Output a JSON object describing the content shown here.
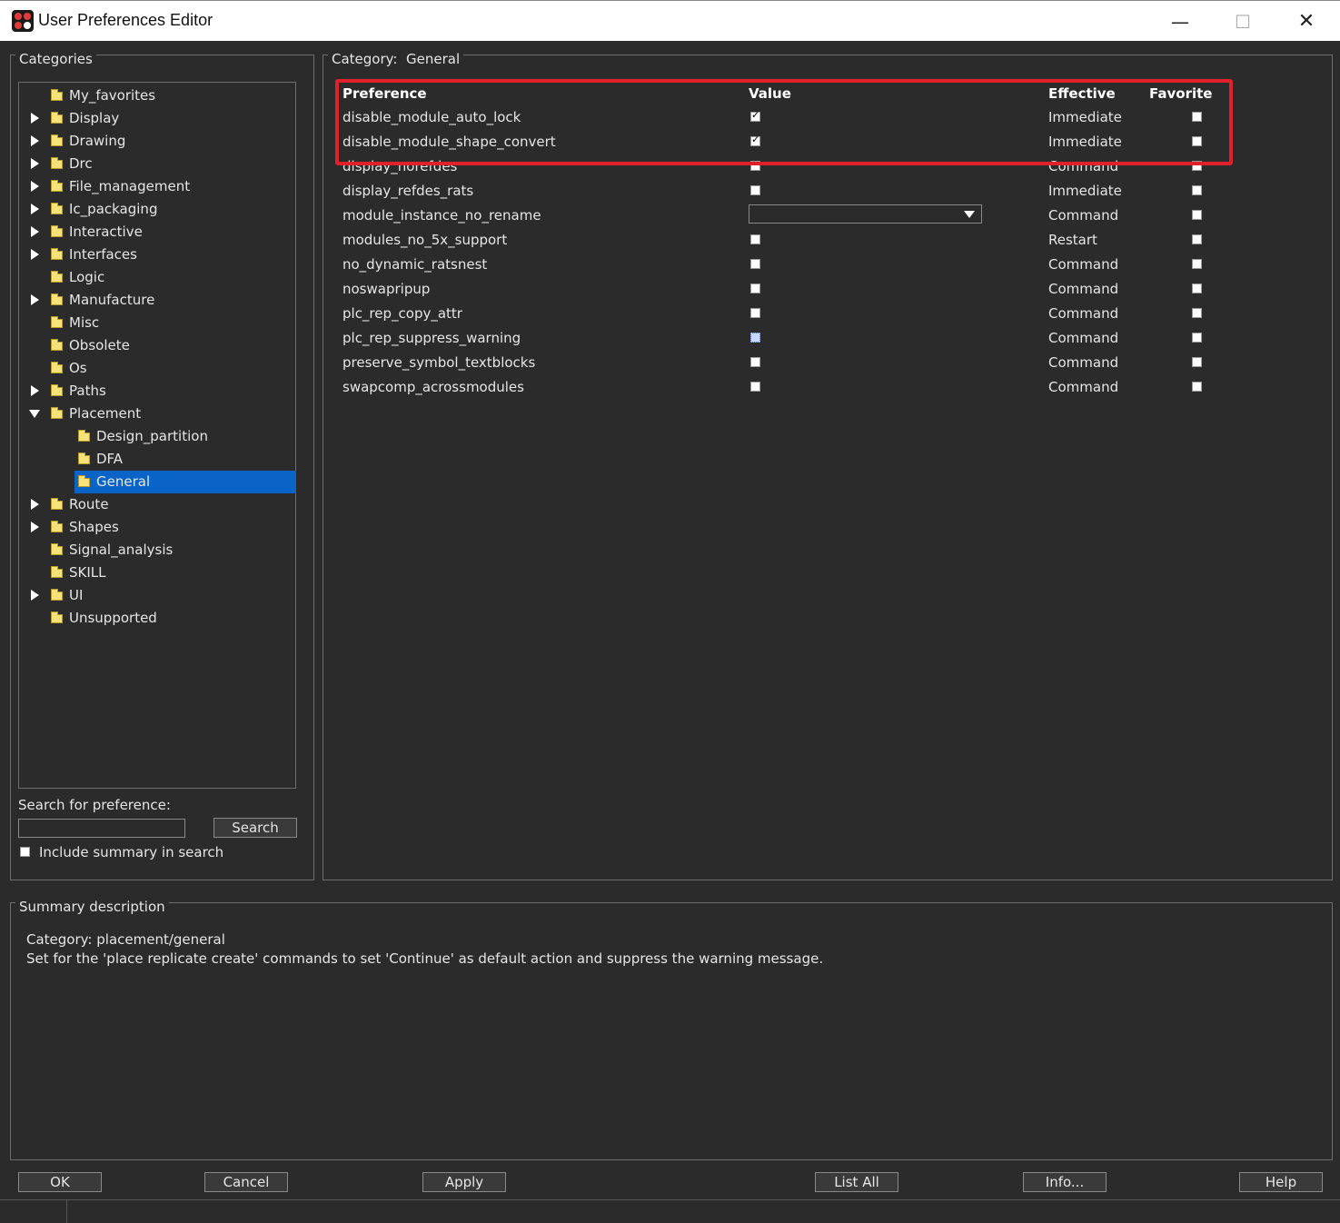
{
  "window": {
    "title": "User Preferences Editor",
    "minimize_glyph": "—",
    "maximize_glyph": "☐",
    "close_glyph": "✕"
  },
  "categories": {
    "label": "Categories",
    "items": [
      {
        "label": "My_favorites",
        "expander": "none",
        "indent": 0
      },
      {
        "label": "Display",
        "expander": "collapsed",
        "indent": 0
      },
      {
        "label": "Drawing",
        "expander": "collapsed",
        "indent": 0
      },
      {
        "label": "Drc",
        "expander": "collapsed",
        "indent": 0
      },
      {
        "label": "File_management",
        "expander": "collapsed",
        "indent": 0
      },
      {
        "label": "Ic_packaging",
        "expander": "collapsed",
        "indent": 0
      },
      {
        "label": "Interactive",
        "expander": "collapsed",
        "indent": 0
      },
      {
        "label": "Interfaces",
        "expander": "collapsed",
        "indent": 0
      },
      {
        "label": "Logic",
        "expander": "none",
        "indent": 0
      },
      {
        "label": "Manufacture",
        "expander": "collapsed",
        "indent": 0
      },
      {
        "label": "Misc",
        "expander": "none",
        "indent": 0
      },
      {
        "label": "Obsolete",
        "expander": "none",
        "indent": 0
      },
      {
        "label": "Os",
        "expander": "none",
        "indent": 0
      },
      {
        "label": "Paths",
        "expander": "collapsed",
        "indent": 0
      },
      {
        "label": "Placement",
        "expander": "expanded",
        "indent": 0
      },
      {
        "label": "Design_partition",
        "expander": "none",
        "indent": 1
      },
      {
        "label": "DFA",
        "expander": "none",
        "indent": 1
      },
      {
        "label": "General",
        "expander": "none",
        "indent": 1,
        "selected": true
      },
      {
        "label": "Route",
        "expander": "collapsed",
        "indent": 0
      },
      {
        "label": "Shapes",
        "expander": "collapsed",
        "indent": 0
      },
      {
        "label": "Signal_analysis",
        "expander": "none",
        "indent": 0
      },
      {
        "label": "SKILL",
        "expander": "none",
        "indent": 0
      },
      {
        "label": "UI",
        "expander": "collapsed",
        "indent": 0
      },
      {
        "label": "Unsupported",
        "expander": "none",
        "indent": 0
      }
    ]
  },
  "search": {
    "label": "Search for preference:",
    "value": "",
    "button": "Search",
    "include_summary_label": "Include summary in search",
    "include_summary_checked": false
  },
  "category_panel": {
    "label": "Category:",
    "value": "General",
    "columns": {
      "preference": "Preference",
      "value": "Value",
      "effective": "Effective",
      "favorite": "Favorite"
    },
    "rows": [
      {
        "name": "disable_module_auto_lock",
        "value_type": "checkbox",
        "checked": true,
        "effective": "Immediate",
        "favorite": false
      },
      {
        "name": "disable_module_shape_convert",
        "value_type": "checkbox",
        "checked": true,
        "effective": "Immediate",
        "favorite": false
      },
      {
        "name": "display_norefdes",
        "value_type": "checkbox",
        "checked": false,
        "effective": "Command",
        "favorite": false
      },
      {
        "name": "display_refdes_rats",
        "value_type": "checkbox",
        "checked": false,
        "effective": "Immediate",
        "favorite": false
      },
      {
        "name": "module_instance_no_rename",
        "value_type": "combo",
        "value": "",
        "effective": "Command",
        "favorite": false
      },
      {
        "name": "modules_no_5x_support",
        "value_type": "checkbox",
        "checked": false,
        "effective": "Restart",
        "favorite": false
      },
      {
        "name": "no_dynamic_ratsnest",
        "value_type": "checkbox",
        "checked": false,
        "effective": "Command",
        "favorite": false
      },
      {
        "name": "noswapripup",
        "value_type": "checkbox",
        "checked": false,
        "effective": "Command",
        "favorite": false
      },
      {
        "name": "plc_rep_copy_attr",
        "value_type": "checkbox",
        "checked": false,
        "effective": "Command",
        "favorite": false
      },
      {
        "name": "plc_rep_suppress_warning",
        "value_type": "checkbox",
        "checked": false,
        "focused": true,
        "effective": "Command",
        "favorite": false
      },
      {
        "name": "preserve_symbol_textblocks",
        "value_type": "checkbox",
        "checked": false,
        "effective": "Command",
        "favorite": false
      },
      {
        "name": "swapcomp_acrossmodules",
        "value_type": "checkbox",
        "checked": false,
        "effective": "Command",
        "favorite": false
      }
    ]
  },
  "summary": {
    "label": "Summary description",
    "line1": "Category: placement/general",
    "line2": "Set for the 'place replicate create' commands to set 'Continue' as default action and suppress the warning message."
  },
  "buttons": {
    "ok": "OK",
    "cancel": "Cancel",
    "apply": "Apply",
    "list_all": "List All",
    "info": "Info...",
    "help": "Help"
  },
  "colors": {
    "background": "#2b2b2b",
    "selection": "#0a64c8",
    "highlight_box": "#e0202a"
  }
}
